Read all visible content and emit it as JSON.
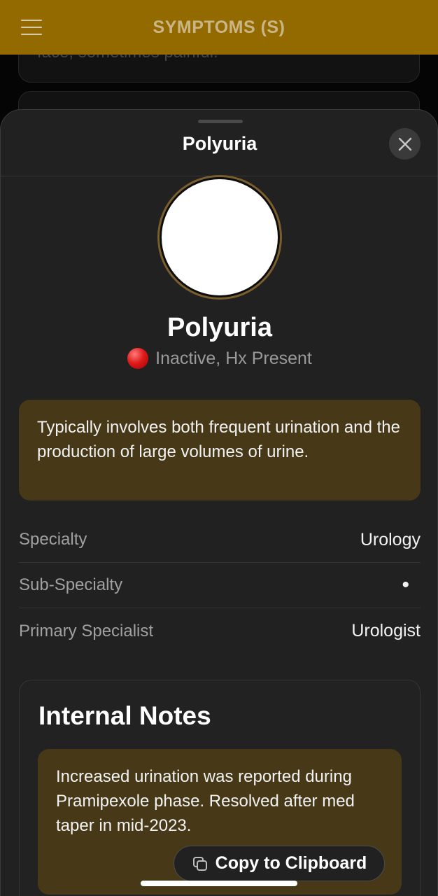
{
  "app_bar": {
    "title": "SYMPTOMS (S)",
    "color": "#936a00",
    "menu_icon": "hamburger-menu-icon"
  },
  "background": {
    "card_text": "face, sometimes painful."
  },
  "sheet": {
    "title": "Polyuria",
    "close_icon": "close-icon",
    "item_name": "Polyuria",
    "status": {
      "text": "Inactive, Hx Present",
      "color": "#e01b1b"
    },
    "description": "Typically involves both frequent urination and the production of large volumes of urine.",
    "info": [
      {
        "label": "Specialty",
        "value": "Urology"
      },
      {
        "label": "Sub-Specialty",
        "value": "•"
      },
      {
        "label": "Primary Specialist",
        "value": "Urologist"
      }
    ],
    "notes": {
      "title": "Internal Notes",
      "text": "Increased urination was reported during Pramipexole phase. Resolved after med taper in mid-2023.",
      "copy_label": "Copy to Clipboard",
      "copy_icon": "copy-icon"
    }
  },
  "accent_color": "#473918"
}
